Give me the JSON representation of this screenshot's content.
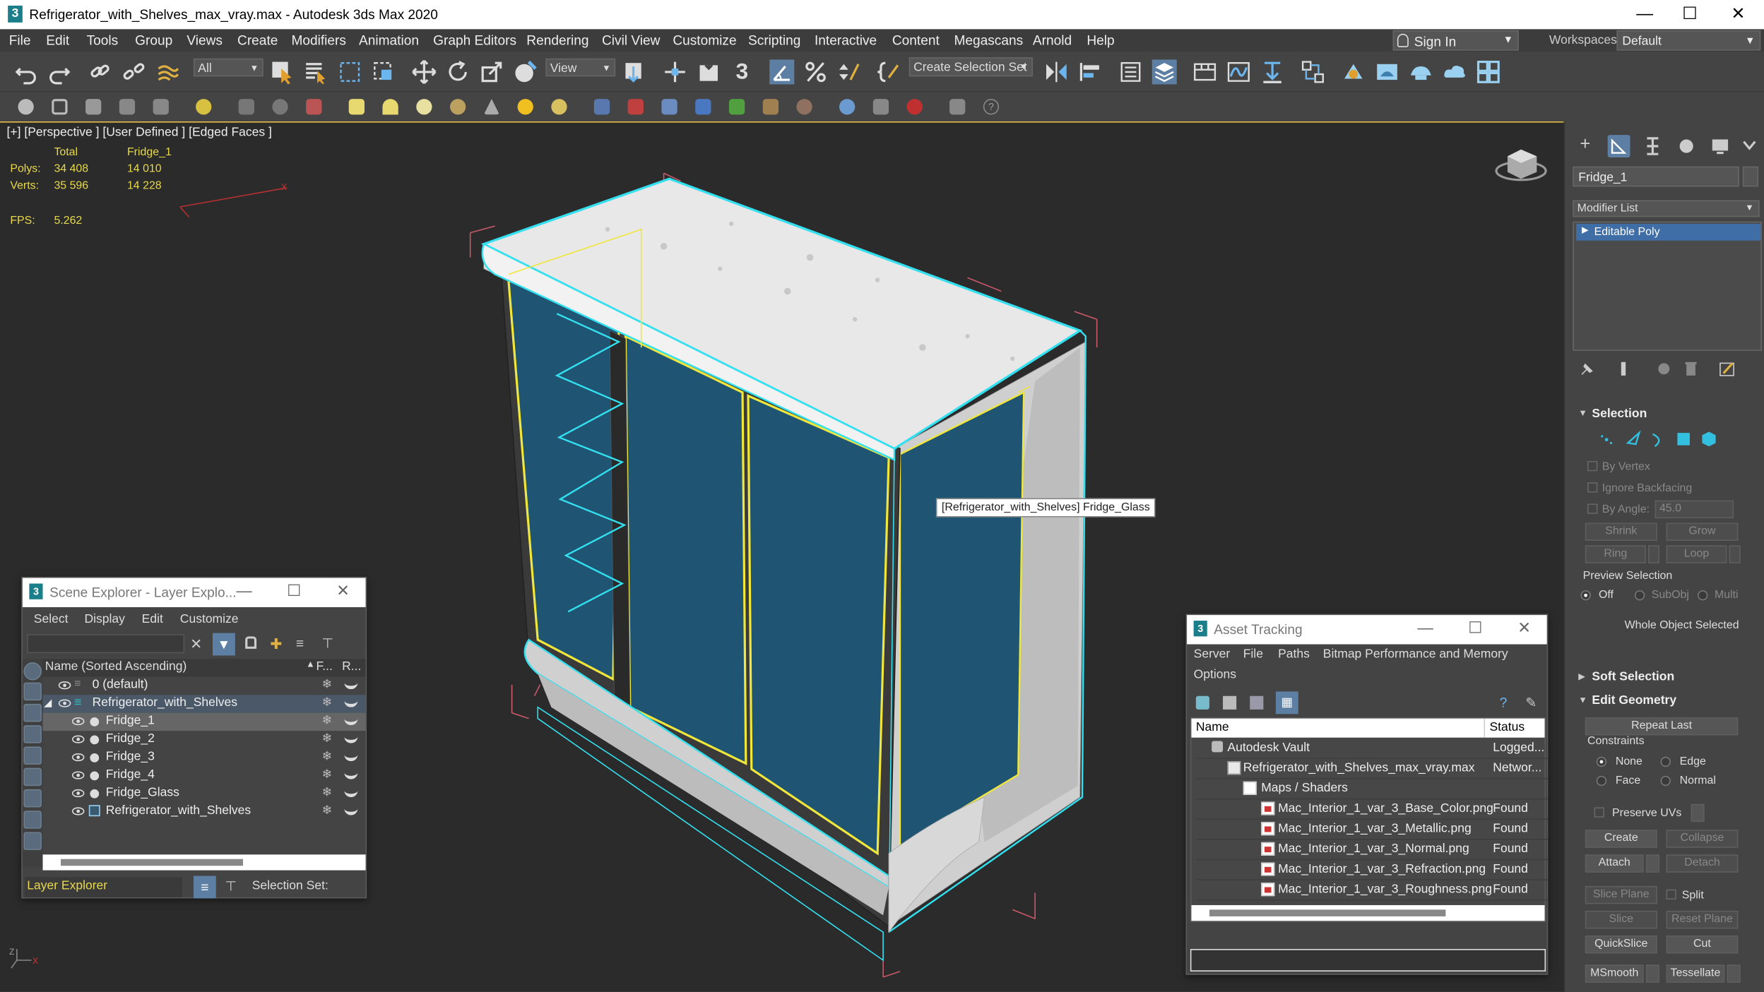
{
  "app": {
    "title": "Refrigerator_with_Shelves_max_vray.max - Autodesk 3ds Max 2020",
    "icon_text": "3"
  },
  "window_controls": {
    "minimize": "—",
    "maximize": "☐",
    "close": "✕"
  },
  "menu": [
    "File",
    "Edit",
    "Tools",
    "Group",
    "Views",
    "Create",
    "Modifiers",
    "Animation",
    "Graph Editors",
    "Rendering",
    "Civil View",
    "Customize",
    "Scripting",
    "Interactive",
    "Content",
    "Megascans",
    "Arnold",
    "Help"
  ],
  "signin": "Sign In",
  "workspaces": {
    "label": "Workspaces:",
    "value": "Default"
  },
  "toolbar": {
    "selection_filter": "All",
    "ref_coord": "View",
    "create_selection_set": "Create Selection Set",
    "snap_label": "3"
  },
  "viewport": {
    "label": "[+] [Perspective ] [User Defined ] [Edged Faces ]",
    "stats": {
      "col_total": "Total",
      "col_object": "Fridge_1",
      "polys_label": "Polys:",
      "polys_total": "34 408",
      "polys_obj": "14 010",
      "verts_label": "Verts:",
      "verts_total": "35 596",
      "verts_obj": "14 228",
      "fps_label": "FPS:",
      "fps_value": "5.262"
    },
    "tooltip": "[Refrigerator_with_Shelves] Fridge_Glass",
    "axis": {
      "x": "x",
      "z": "z"
    }
  },
  "command_panel": {
    "object_name": "Fridge_1",
    "modifier_list": "Modifier List",
    "stack_item": "Editable Poly",
    "selection": {
      "title": "Selection",
      "by_vertex": "By Vertex",
      "ignore_backfacing": "Ignore Backfacing",
      "by_angle": "By Angle:",
      "angle_value": "45.0",
      "shrink": "Shrink",
      "grow": "Grow",
      "ring": "Ring",
      "loop": "Loop",
      "preview_selection": "Preview Selection",
      "off": "Off",
      "subobj": "SubObj",
      "multi": "Multi",
      "status": "Whole Object Selected"
    },
    "soft_selection": "Soft Selection",
    "edit_geometry": {
      "title": "Edit Geometry",
      "repeat_last": "Repeat Last",
      "constraints": "Constraints",
      "none": "None",
      "edge": "Edge",
      "face": "Face",
      "normal": "Normal",
      "preserve_uvs": "Preserve UVs",
      "create": "Create",
      "collapse": "Collapse",
      "attach": "Attach",
      "detach": "Detach",
      "slice_plane": "Slice Plane",
      "split": "Split",
      "slice": "Slice",
      "reset_plane": "Reset Plane",
      "quickslice": "QuickSlice",
      "cut": "Cut",
      "msmooth": "MSmooth",
      "tessellate": "Tessellate"
    }
  },
  "scene_explorer": {
    "title": "Scene Explorer - Layer Explo...",
    "menu": [
      "Select",
      "Display",
      "Edit",
      "Customize"
    ],
    "col_name": "Name (Sorted Ascending)",
    "col_f": "F...",
    "col_r": "R...",
    "rows": [
      {
        "name": "0 (default)",
        "level": 0,
        "type": "layer"
      },
      {
        "name": "Refrigerator_with_Shelves",
        "level": 0,
        "type": "layer-open"
      },
      {
        "name": "Fridge_1",
        "level": 1,
        "type": "object"
      },
      {
        "name": "Fridge_2",
        "level": 1,
        "type": "object"
      },
      {
        "name": "Fridge_3",
        "level": 1,
        "type": "object"
      },
      {
        "name": "Fridge_4",
        "level": 1,
        "type": "object"
      },
      {
        "name": "Fridge_Glass",
        "level": 1,
        "type": "object"
      },
      {
        "name": "Refrigerator_with_Shelves",
        "level": 1,
        "type": "group"
      }
    ],
    "footer_dropdown": "Layer Explorer",
    "selection_set": "Selection Set:"
  },
  "asset_tracking": {
    "title": "Asset Tracking",
    "menu": [
      "Server",
      "File",
      "Paths",
      "Bitmap Performance and Memory",
      "Options"
    ],
    "col_name": "Name",
    "col_status": "Status",
    "rows": [
      {
        "name": "Autodesk Vault",
        "status": "Logged...",
        "indent": 0
      },
      {
        "name": "Refrigerator_with_Shelves_max_vray.max",
        "status": "Networ...",
        "indent": 1
      },
      {
        "name": "Maps / Shaders",
        "status": "",
        "indent": 2
      },
      {
        "name": "Mac_Interior_1_var_3_Base_Color.png",
        "status": "Found",
        "indent": 3
      },
      {
        "name": "Mac_Interior_1_var_3_Metallic.png",
        "status": "Found",
        "indent": 3
      },
      {
        "name": "Mac_Interior_1_var_3_Normal.png",
        "status": "Found",
        "indent": 3
      },
      {
        "name": "Mac_Interior_1_var_3_Refraction.png",
        "status": "Found",
        "indent": 3
      },
      {
        "name": "Mac_Interior_1_var_3_Roughness.png",
        "status": "Found",
        "indent": 3
      }
    ]
  },
  "colors": {
    "accent": "#3f6ea7",
    "selection_cyan": "#33e0f0",
    "selection_yellow": "#f0e63c",
    "glass": "#1f5573",
    "stat_yellow": "#e8d94a"
  }
}
